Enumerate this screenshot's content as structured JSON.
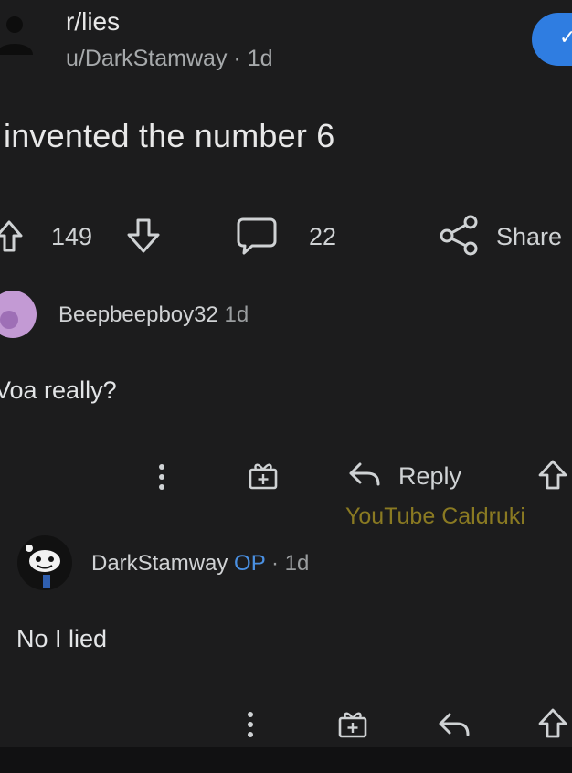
{
  "post": {
    "subreddit": "r/lies",
    "author": "u/DarkStamway",
    "time": "1d",
    "title": "invented the number 6",
    "upvotes": "149",
    "comments": "22",
    "share_label": "Share"
  },
  "comments": [
    {
      "author": "Beepbeepboy32",
      "time": "1d",
      "body": "Voa really?",
      "reply_label": "Reply"
    },
    {
      "author": "DarkStamway",
      "op_label": "OP",
      "time": "1d",
      "body": "No I lied"
    }
  ],
  "watermark": "YouTube Caldruki",
  "colors": {
    "background": "#1c1c1d",
    "accent": "#2f7de1",
    "op": "#4a90e2",
    "watermark": "#8a7a22"
  }
}
